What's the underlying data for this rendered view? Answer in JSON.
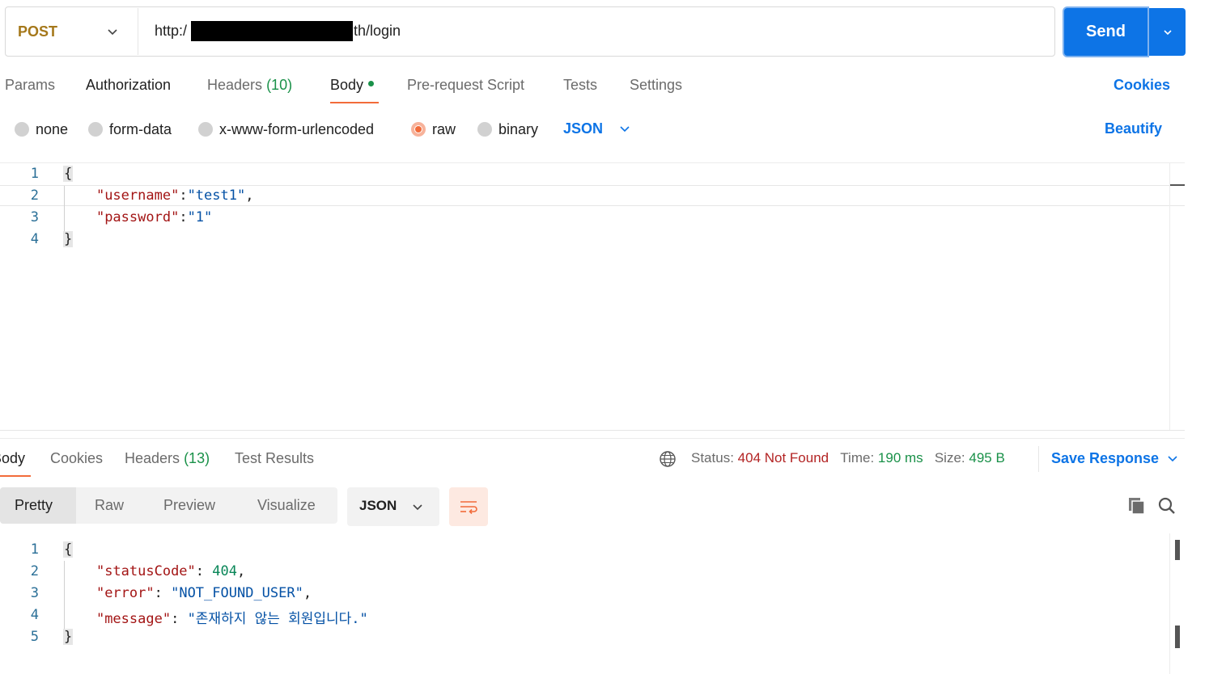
{
  "request": {
    "method": "POST",
    "url_prefix": "http:/",
    "url_suffix": "th/login",
    "send_label": "Send"
  },
  "request_tabs": {
    "params": "Params",
    "authorization": "Authorization",
    "headers": "Headers",
    "headers_count": "(10)",
    "body": "Body",
    "prerequest": "Pre-request Script",
    "tests": "Tests",
    "settings": "Settings",
    "cookies": "Cookies"
  },
  "body_types": {
    "none": "none",
    "form_data": "form-data",
    "urlencoded": "x-www-form-urlencoded",
    "raw": "raw",
    "binary": "binary",
    "selected": "raw",
    "language": "JSON",
    "beautify": "Beautify"
  },
  "request_body": {
    "line_numbers": [
      "1",
      "2",
      "3",
      "4"
    ],
    "open": "{",
    "close": "}",
    "k1": "\"username\"",
    "v1": "\"test1\"",
    "k2": "\"password\"",
    "v2": "\"1\""
  },
  "response_tabs": {
    "body": "Body",
    "cookies": "Cookies",
    "headers": "Headers",
    "headers_count": "(13)",
    "test_results": "Test Results"
  },
  "response_status": {
    "status_label": "Status:",
    "status_value": "404 Not Found",
    "time_label": "Time:",
    "time_value": "190 ms",
    "size_label": "Size:",
    "size_value": "495 B",
    "save_response": "Save Response"
  },
  "response_view": {
    "pretty": "Pretty",
    "raw": "Raw",
    "preview": "Preview",
    "visualize": "Visualize",
    "format": "JSON"
  },
  "response_body": {
    "line_numbers": [
      "1",
      "2",
      "3",
      "4",
      "5"
    ],
    "open": "{",
    "close": "}",
    "k1": "\"statusCode\"",
    "v1": "404",
    "k2": "\"error\"",
    "v2": "\"NOT_FOUND_USER\"",
    "k3": "\"message\"",
    "v3": "\"존재하지 않는 회원입니다.\""
  },
  "colors": {
    "accent_blue": "#0d74e6",
    "method_post": "#a5781b",
    "active_tab_underline": "#f26b3a",
    "status_error": "#b32424",
    "status_ok": "#1a9149"
  },
  "icons": [
    "chevron-down-icon",
    "globe-icon",
    "wrap-lines-icon",
    "copy-icon",
    "search-icon"
  ]
}
